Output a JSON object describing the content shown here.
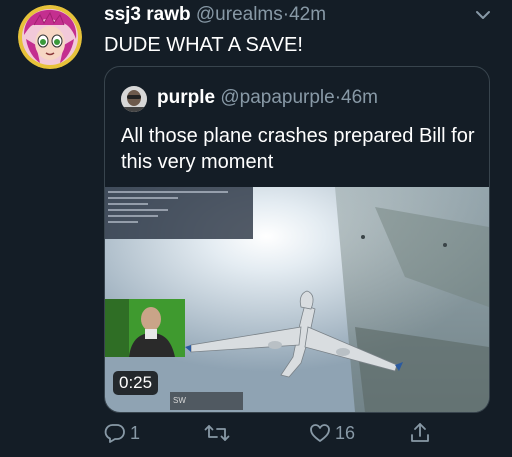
{
  "tweet": {
    "display_name": "ssj3 rawb",
    "handle": "@urealms",
    "separator": "·",
    "time": "42m",
    "text": "DUDE WHAT A SAVE!",
    "avatar_icon": "anime-character-avatar",
    "menu_icon": "chevron-down-icon"
  },
  "quote": {
    "display_name": "purple",
    "handle": "@papapurple",
    "separator": "·",
    "time": "46m",
    "text": "All those plane crashes prepared Bill for this very moment",
    "avatar_icon": "user-avatar",
    "media": {
      "duration": "0:25",
      "content": "video-plane-crash"
    }
  },
  "actions": {
    "reply": {
      "icon": "reply-icon",
      "count": "1"
    },
    "retweet": {
      "icon": "retweet-icon",
      "count": ""
    },
    "like": {
      "icon": "heart-icon",
      "count": "16"
    },
    "share": {
      "icon": "share-icon",
      "count": ""
    }
  },
  "colors": {
    "background": "#141d26",
    "secondary_text": "#8899a6",
    "border": "#38444d",
    "avatar_ring": "#e6c23a"
  }
}
